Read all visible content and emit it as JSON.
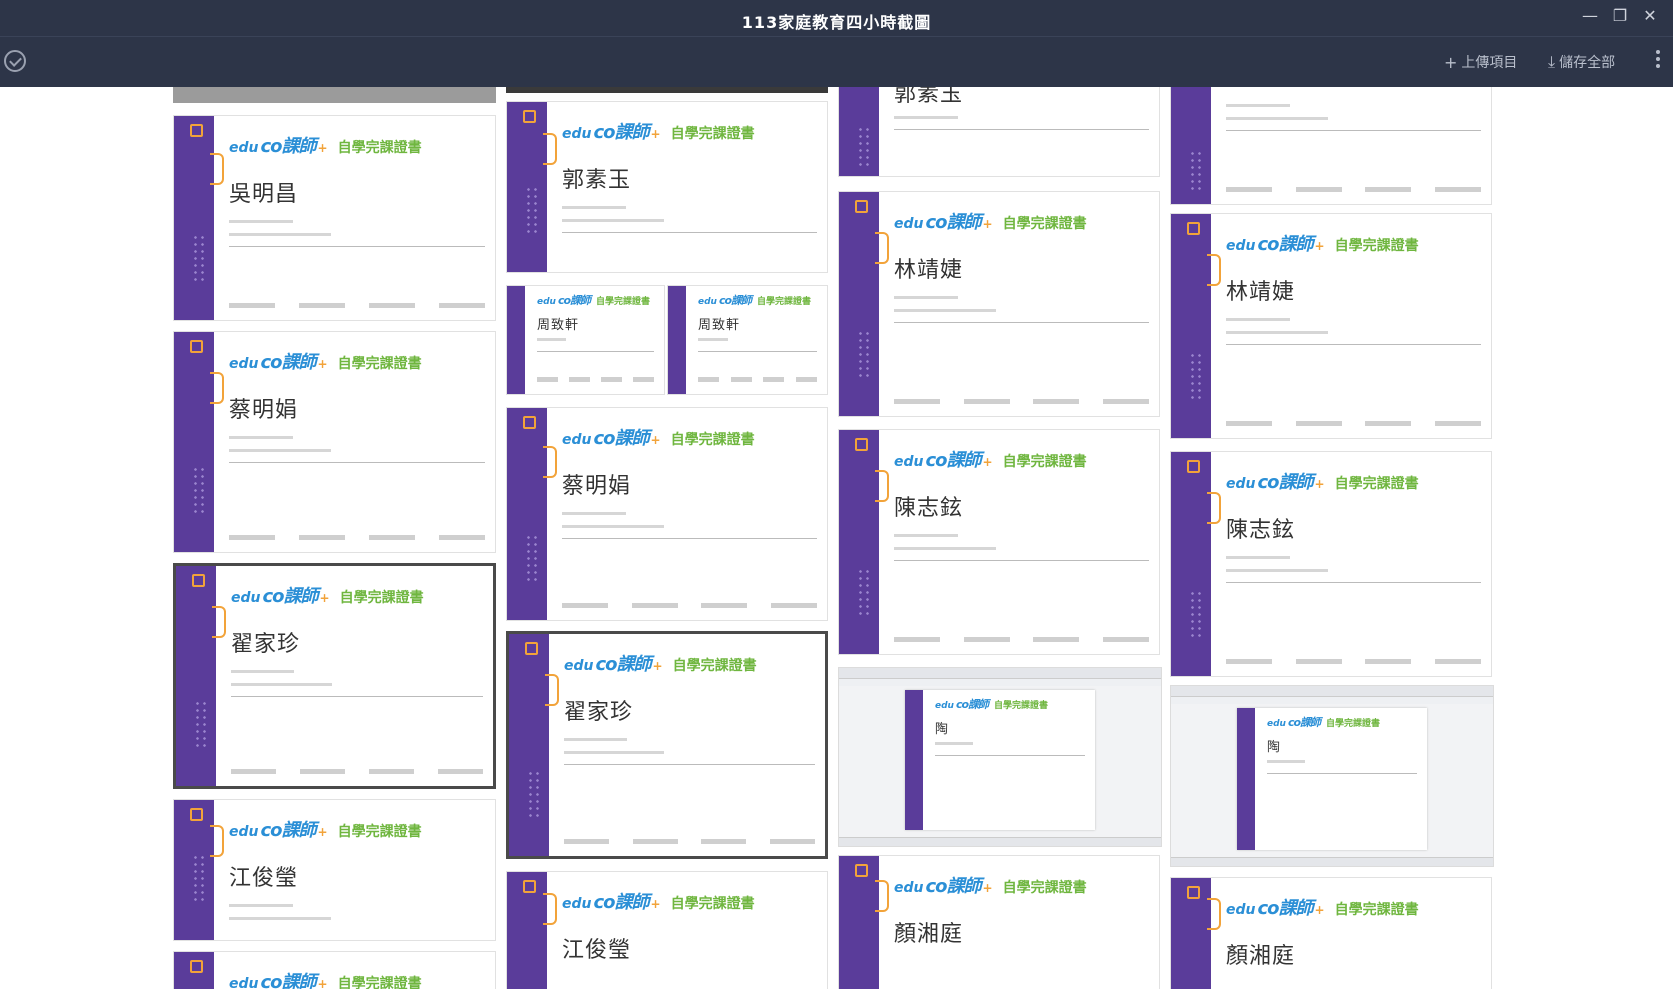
{
  "window": {
    "title": "113家庭教育四小時截圖"
  },
  "toolbar": {
    "upload_label": "上傳項目",
    "save_all_label": "儲存全部"
  },
  "certificate": {
    "logo_edu": "edu",
    "logo_brand": "co課師",
    "logo_cert": "自學完課證書"
  },
  "cards": {
    "c1": {
      "name": "吳明昌"
    },
    "c2": {
      "name": "蔡明娟"
    },
    "c3": {
      "name": "翟家珍"
    },
    "c4": {
      "name": "江俊瑩"
    },
    "c5": {
      "name": "郭素玉"
    },
    "c6": {
      "name": "周致軒"
    },
    "c7": {
      "name": "周致軒"
    },
    "c8": {
      "name": "蔡明娟"
    },
    "c9": {
      "name": "翟家珍"
    },
    "c10": {
      "name": "江俊瑩"
    },
    "c11": {
      "name": "郭素玉"
    },
    "c12": {
      "name": "林靖婕"
    },
    "c13": {
      "name": "陳志鉉"
    },
    "c14": {
      "name": "陶"
    },
    "c15": {
      "name": "顏湘庭"
    },
    "c16": {
      "name": "林靖婕"
    },
    "c17": {
      "name": "陳志鉉"
    },
    "c18": {
      "name": "陶"
    },
    "c19": {
      "name": "顏湘庭"
    }
  }
}
